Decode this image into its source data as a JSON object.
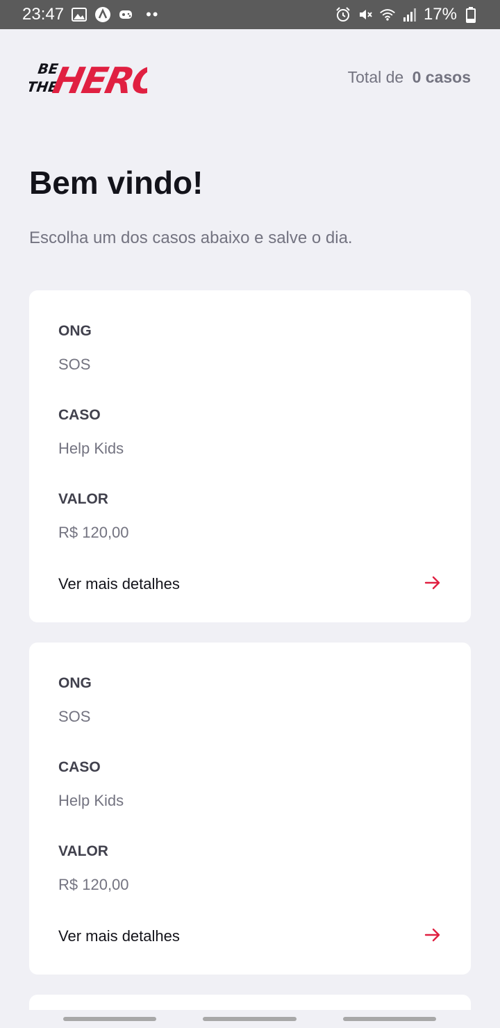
{
  "status_bar": {
    "time": "23:47",
    "battery": "17%",
    "icons": [
      "image-icon",
      "a-circle-icon",
      "game-icon",
      "more-dots-icon",
      "alarm-icon",
      "mute-icon",
      "wifi-icon",
      "signal-icon",
      "battery-icon"
    ]
  },
  "header": {
    "logo_text": {
      "be": "BE",
      "the": "THE",
      "hero": "HERO"
    },
    "total_prefix": "Total de",
    "total_value": "0 casos"
  },
  "page_title": "Bem vindo!",
  "page_subtitle": "Escolha um dos casos abaixo e salve o dia.",
  "incidents": [
    {
      "ong_label": "ONG",
      "ong_value": "SOS",
      "case_label": "CASO",
      "case_value": "Help Kids",
      "value_label": "VALOR",
      "value_value": "R$ 120,00",
      "details_label": "Ver mais detalhes"
    },
    {
      "ong_label": "ONG",
      "ong_value": "SOS",
      "case_label": "CASO",
      "case_value": "Help Kids",
      "value_label": "VALOR",
      "value_value": "R$ 120,00",
      "details_label": "Ver mais detalhes"
    }
  ],
  "colors": {
    "accent": "#e02041",
    "background": "#f0f0f5",
    "card": "#ffffff",
    "title": "#13131a",
    "muted": "#737380"
  }
}
